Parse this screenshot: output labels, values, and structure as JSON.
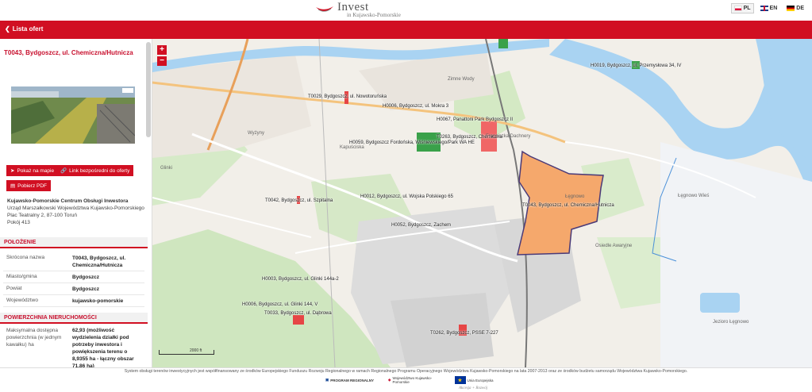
{
  "header": {
    "logo_line1": "Invest",
    "logo_line2": "in Kujawsko-Pomorskie",
    "languages": [
      {
        "code": "PL",
        "active": true
      },
      {
        "code": "EN",
        "active": false
      },
      {
        "code": "DE",
        "active": false
      }
    ]
  },
  "nav": {
    "back_label": "Lista ofert"
  },
  "offer": {
    "title": "T0043, Bydgoszcz, ul. Chemiczna/Hutnicza",
    "buttons": {
      "show_on_map": "Pokaż na mapie",
      "direct_link": "Link bezpośredni do oferty",
      "download_pdf": "Pobierz PDF"
    },
    "contact": {
      "org": "Kujawsko-Pomorskie Centrum Obsługi Inwestora",
      "office": "Urząd Marszałkowski Województwa Kujawsko-Pomorskiego",
      "address": "Plac Teatralny 2, 87-100 Toruń",
      "room": "Pokój 413"
    },
    "location_section": "POŁOŻENIE",
    "location_rows": [
      {
        "key": "Skrócona nazwa",
        "value": "T0043, Bydgoszcz, ul. Chemiczna/Hutnicza"
      },
      {
        "key": "Miasto/gmina",
        "value": "Bydgoszcz"
      },
      {
        "key": "Powiat",
        "value": "Bydgoszcz"
      },
      {
        "key": "Województwo",
        "value": "kujawsko-pomorskie"
      }
    ],
    "area_section": "POWIERZCHNIA NIERUCHOMOŚCI",
    "area_rows": [
      {
        "key": "Maksymalna dostępna powierzchnia (w jednym kawałku) ha",
        "value": "62,93 (możliwość wydzielenia działki pod potrzeby inwestora i powiększenia terenu o 8,9355 ha - łączny obszar 71,86 ha)"
      }
    ]
  },
  "map": {
    "zoom_in": "+",
    "zoom_out": "−",
    "scale_label": "2000 ft",
    "plots": [
      "T0043, Bydgoszcz, ul. Chemiczna/Hutnicza",
      "T0029, Bydgoszcz, ul. Nowotoruńska",
      "H0006, Bydgoszcz, ul. Mokra 3",
      "H0067, Panattoni Park Bydgoszcz II",
      "T0263, Bydgoszcz, Chemiczna",
      "H0059, Bydgoszcz Fordońska, Wiśniewskiego/Park WA HE",
      "H0019, Bydgoszcz, ul. Przemysłowa 34, IV",
      "T0042, Bydgoszcz, ul. Szpitalna",
      "H0012, Bydgoszcz, ul. Wojska Polskiego 65",
      "H0052, Bydgoszcz, Zachem",
      "H0003, Bydgoszcz, ul. Glinki 144a-2",
      "H0006, Bydgoszcz, ul. Glinki 144, V",
      "T0033, Bydgoszcz, ul. Dąbrowa",
      "T0262, Bydgoszcz, PSSE 7-227"
    ],
    "places": [
      "Zimne Wody",
      "Łęgnowo",
      "Osiedle Awaryjne",
      "Łęgnowo Wieś",
      "Jezioro Łęgnowo",
      "Wyżyny",
      "Kapuściska",
      "Glinki",
      "Franciszka Dachnery"
    ]
  },
  "footer": {
    "text": "System obsługi terenów inwestycyjnych jest współfinansowany ze środków Europejskiego Funduszu Rozwoju Regionalnego w ramach Regionalnego Programu Operacyjnego Województwa Kujawsko-Pomorskiego na lata 2007-2013 oraz ze środków budżetu samorządu Województwa Kujawsko-Pomorskiego.",
    "logo_program": "PROGRAM REGIONALNY",
    "logo_region": "Województwo Kujawsko-Pomorskie",
    "logo_eu": "Unia Europejska",
    "slogan": "Akcesja + Rozwój"
  },
  "colors": {
    "brand_red": "#d10f22",
    "plot_orange": "#f5a86c",
    "water": "#a9d3f2"
  }
}
